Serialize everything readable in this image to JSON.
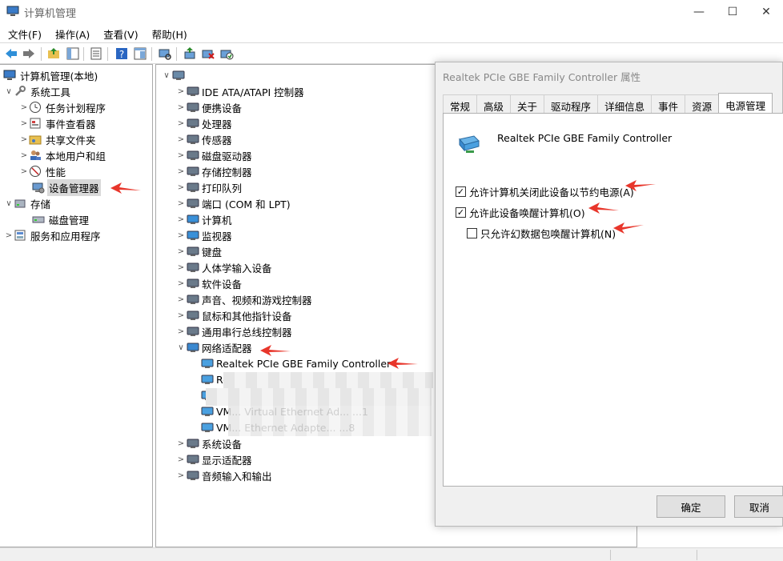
{
  "window": {
    "title": "计算机管理"
  },
  "menu": [
    "文件(F)",
    "操作(A)",
    "查看(V)",
    "帮助(H)"
  ],
  "left_tree": [
    {
      "label": "计算机管理(本地)",
      "indent": 0,
      "chev": "",
      "icon": "computer-management-icon"
    },
    {
      "label": "系统工具",
      "indent": 1,
      "chev": "∨",
      "icon": "tools-icon"
    },
    {
      "label": "任务计划程序",
      "indent": 2,
      "chev": ">",
      "icon": "clock-icon"
    },
    {
      "label": "事件查看器",
      "indent": 2,
      "chev": ">",
      "icon": "event-viewer-icon"
    },
    {
      "label": "共享文件夹",
      "indent": 2,
      "chev": ">",
      "icon": "shared-folder-icon"
    },
    {
      "label": "本地用户和组",
      "indent": 2,
      "chev": ">",
      "icon": "users-icon"
    },
    {
      "label": "性能",
      "indent": 2,
      "chev": ">",
      "icon": "performance-icon"
    },
    {
      "label": "设备管理器",
      "indent": 2,
      "chev": "",
      "icon": "device-manager-icon",
      "selected": true
    },
    {
      "label": "存储",
      "indent": 1,
      "chev": "∨",
      "icon": "storage-icon"
    },
    {
      "label": "磁盘管理",
      "indent": 2,
      "chev": "",
      "icon": "disk-icon"
    },
    {
      "label": "服务和应用程序",
      "indent": 1,
      "chev": ">",
      "icon": "services-icon"
    }
  ],
  "device_tree": [
    {
      "label": "",
      "indent": 0,
      "chev": "∨",
      "icon": "computer-icon"
    },
    {
      "label": "IDE ATA/ATAPI 控制器",
      "indent": 1,
      "chev": ">",
      "icon": "ide-controller-icon"
    },
    {
      "label": "便携设备",
      "indent": 1,
      "chev": ">",
      "icon": "portable-device-icon"
    },
    {
      "label": "处理器",
      "indent": 1,
      "chev": ">",
      "icon": "processor-icon"
    },
    {
      "label": "传感器",
      "indent": 1,
      "chev": ">",
      "icon": "sensor-icon"
    },
    {
      "label": "磁盘驱动器",
      "indent": 1,
      "chev": ">",
      "icon": "disk-drive-icon"
    },
    {
      "label": "存储控制器",
      "indent": 1,
      "chev": ">",
      "icon": "storage-controller-icon"
    },
    {
      "label": "打印队列",
      "indent": 1,
      "chev": ">",
      "icon": "printer-icon"
    },
    {
      "label": "端口 (COM 和 LPT)",
      "indent": 1,
      "chev": ">",
      "icon": "port-icon"
    },
    {
      "label": "计算机",
      "indent": 1,
      "chev": ">",
      "icon": "monitor-icon"
    },
    {
      "label": "监视器",
      "indent": 1,
      "chev": ">",
      "icon": "display-icon"
    },
    {
      "label": "键盘",
      "indent": 1,
      "chev": ">",
      "icon": "keyboard-icon"
    },
    {
      "label": "人体学输入设备",
      "indent": 1,
      "chev": ">",
      "icon": "hid-icon"
    },
    {
      "label": "软件设备",
      "indent": 1,
      "chev": ">",
      "icon": "software-device-icon"
    },
    {
      "label": "声音、视频和游戏控制器",
      "indent": 1,
      "chev": ">",
      "icon": "speaker-icon"
    },
    {
      "label": "鼠标和其他指针设备",
      "indent": 1,
      "chev": ">",
      "icon": "mouse-icon"
    },
    {
      "label": "通用串行总线控制器",
      "indent": 1,
      "chev": ">",
      "icon": "usb-icon"
    },
    {
      "label": "网络适配器",
      "indent": 1,
      "chev": "∨",
      "icon": "network-adapter-icon"
    },
    {
      "label": "Realtek PCIe GBE Family Controller",
      "indent": 2,
      "chev": "",
      "icon": "network-card-icon"
    },
    {
      "label": "Realtek RTL8192... Wireless ...GE",
      "indent": 2,
      "chev": "",
      "icon": "network-card-icon"
    },
    {
      "label": "",
      "indent": 2,
      "chev": "",
      "icon": "network-card-icon"
    },
    {
      "label": "VM... Virtual Ethernet Ad... ...1",
      "indent": 2,
      "chev": "",
      "icon": "network-card-icon"
    },
    {
      "label": "VM... Ethernet Adapte... ...8",
      "indent": 2,
      "chev": "",
      "icon": "network-card-icon"
    },
    {
      "label": "系统设备",
      "indent": 1,
      "chev": ">",
      "icon": "system-device-icon"
    },
    {
      "label": "显示适配器",
      "indent": 1,
      "chev": ">",
      "icon": "display-adapter-icon"
    },
    {
      "label": "音频输入和输出",
      "indent": 1,
      "chev": ">",
      "icon": "audio-icon"
    }
  ],
  "dialog": {
    "title": "Realtek PCIe GBE Family Controller 属性",
    "tabs": [
      "常规",
      "高级",
      "关于",
      "驱动程序",
      "详细信息",
      "事件",
      "资源",
      "电源管理"
    ],
    "active_tab": "电源管理",
    "device_name": "Realtek PCIe GBE Family Controller",
    "options": [
      {
        "label": "允许计算机关闭此设备以节约电源(A)",
        "checked": true
      },
      {
        "label": "允许此设备唤醒计算机(O)",
        "checked": true
      },
      {
        "label": "只允许幻数据包唤醒计算机(N)",
        "checked": false
      }
    ],
    "ok_label": "确定",
    "cancel_label": "取消"
  },
  "colors": {
    "arrow": "#e8362b",
    "accent": "#1e73be"
  }
}
